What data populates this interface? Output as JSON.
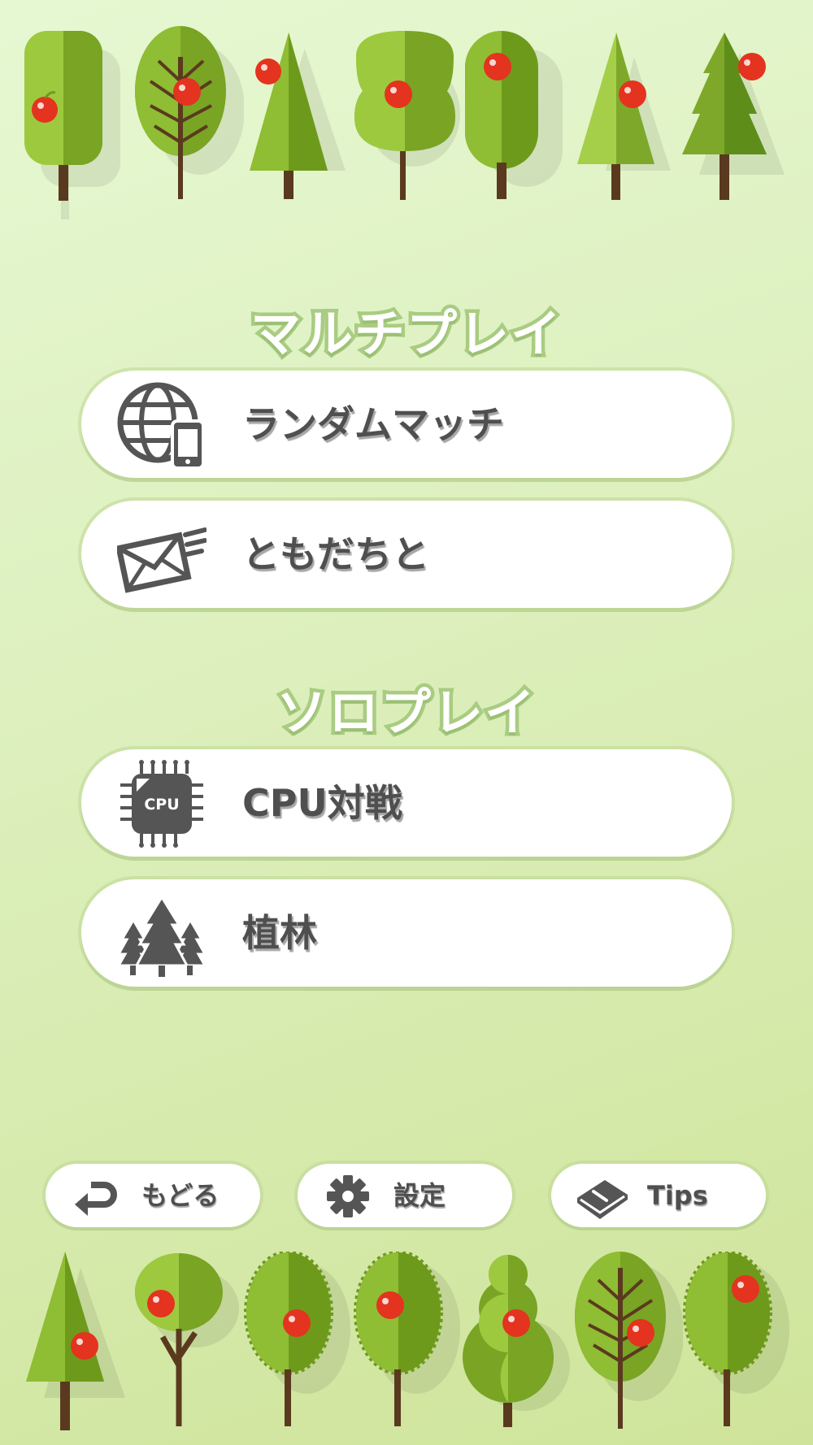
{
  "multiplay": {
    "title": "マルチプレイ",
    "random_match_label": "ランダムマッチ",
    "friends_label": "ともだちと"
  },
  "soloplay": {
    "title": "ソロプレイ",
    "cpu_label": "CPU対戦",
    "cpu_chip_text": "CPU",
    "planting_label": "植林"
  },
  "footer": {
    "back_label": "もどる",
    "settings_label": "設定",
    "tips_label": "Tips"
  },
  "icons": {
    "random_match": "globe-phone-icon",
    "friends": "envelope-icon",
    "cpu": "cpu-chip-icon",
    "planting": "forest-icon",
    "back": "return-arrow-icon",
    "settings": "gear-icon",
    "tips": "book-icon"
  },
  "colors": {
    "background": "#dcefbc",
    "tree_light": "#9dc93f",
    "tree_dark": "#6e9a1c",
    "trunk": "#5a3a1e",
    "apple": "#e4331f",
    "label": "#4f4f4f",
    "title_outline": "#a9cc82"
  }
}
